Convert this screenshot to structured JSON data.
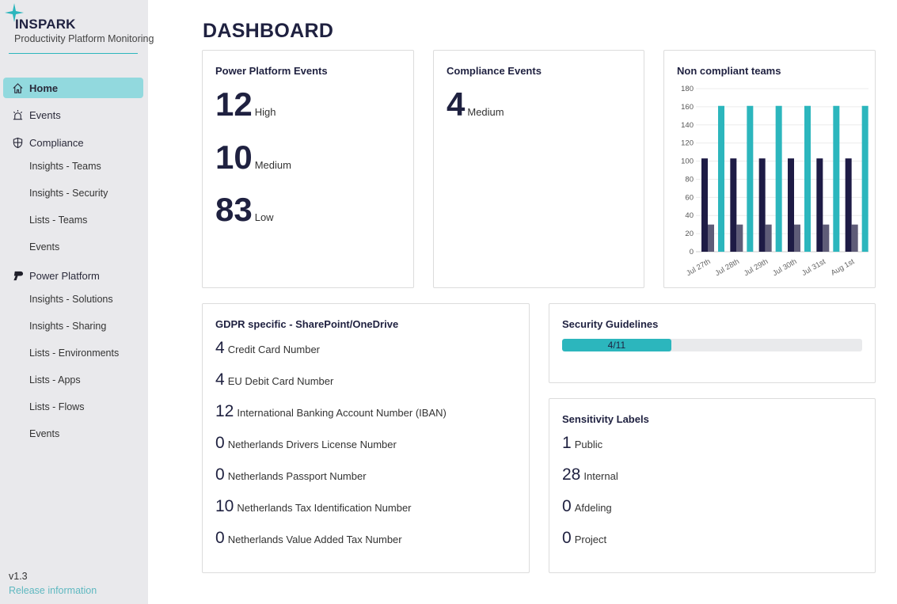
{
  "brand": {
    "name": "INSPARK",
    "subtitle": "Productivity Platform Monitoring"
  },
  "sidebar": {
    "items": [
      {
        "label": "Home",
        "icon": "home-icon",
        "active": true
      },
      {
        "label": "Events",
        "icon": "alarm-icon"
      },
      {
        "label": "Compliance",
        "icon": "shield-icon"
      },
      {
        "label": "Insights - Teams",
        "sub": true
      },
      {
        "label": "Insights - Security",
        "sub": true
      },
      {
        "label": "Lists - Teams",
        "sub": true
      },
      {
        "label": "Events",
        "sub": true
      },
      {
        "label": "Power Platform",
        "icon": "power-platform-icon"
      },
      {
        "label": "Insights - Solutions",
        "sub": true
      },
      {
        "label": "Insights - Sharing",
        "sub": true
      },
      {
        "label": "Lists - Environments",
        "sub": true
      },
      {
        "label": "Lists - Apps",
        "sub": true
      },
      {
        "label": "Lists - Flows",
        "sub": true
      },
      {
        "label": "Events",
        "sub": true
      }
    ],
    "version": "v1.3",
    "release_link": "Release information"
  },
  "page_title": "DASHBOARD",
  "power_platform_events": {
    "title": "Power Platform Events",
    "rows": [
      {
        "value": "12",
        "label": "High"
      },
      {
        "value": "10",
        "label": "Medium"
      },
      {
        "value": "83",
        "label": "Low"
      }
    ]
  },
  "compliance_events": {
    "title": "Compliance Events",
    "rows": [
      {
        "value": "4",
        "label": "Medium"
      }
    ]
  },
  "gdpr": {
    "title": "GDPR specific - SharePoint/OneDrive",
    "rows": [
      {
        "value": "4",
        "label": "Credit Card Number"
      },
      {
        "value": "4",
        "label": "EU Debit Card Number"
      },
      {
        "value": "12",
        "label": "International Banking Account Number (IBAN)"
      },
      {
        "value": "0",
        "label": "Netherlands Drivers License Number"
      },
      {
        "value": "0",
        "label": "Netherlands Passport Number"
      },
      {
        "value": "10",
        "label": "Netherlands Tax Identification Number"
      },
      {
        "value": "0",
        "label": "Netherlands Value Added Tax Number"
      }
    ]
  },
  "security_guidelines": {
    "title": "Security Guidelines",
    "progress_label": "4/11",
    "done": 4,
    "total": 11
  },
  "sensitivity_labels": {
    "title": "Sensitivity Labels",
    "rows": [
      {
        "value": "1",
        "label": "Public"
      },
      {
        "value": "28",
        "label": "Internal"
      },
      {
        "value": "0",
        "label": "Afdeling"
      },
      {
        "value": "0",
        "label": "Project"
      }
    ]
  },
  "chart_data": {
    "type": "bar",
    "title": "Non compliant teams",
    "categories": [
      "Jul 27th",
      "Jul 28th",
      "Jul 29th",
      "Jul 30th",
      "Jul 31st",
      "Aug 1st"
    ],
    "series": [
      {
        "name": "series-1",
        "color": "#1e1b45",
        "values": [
          103,
          103,
          103,
          103,
          103,
          103
        ]
      },
      {
        "name": "series-2",
        "color": "#5f5c78",
        "values": [
          30,
          30,
          30,
          30,
          30,
          30
        ]
      },
      {
        "name": "series-3",
        "color": "#2cb6bd",
        "values": [
          161,
          161,
          161,
          161,
          161,
          161
        ]
      }
    ],
    "yticks": [
      0,
      20,
      40,
      60,
      80,
      100,
      120,
      140,
      160,
      180
    ],
    "ylim": [
      0,
      180
    ],
    "grid": true,
    "xlabel": "",
    "ylabel": ""
  }
}
